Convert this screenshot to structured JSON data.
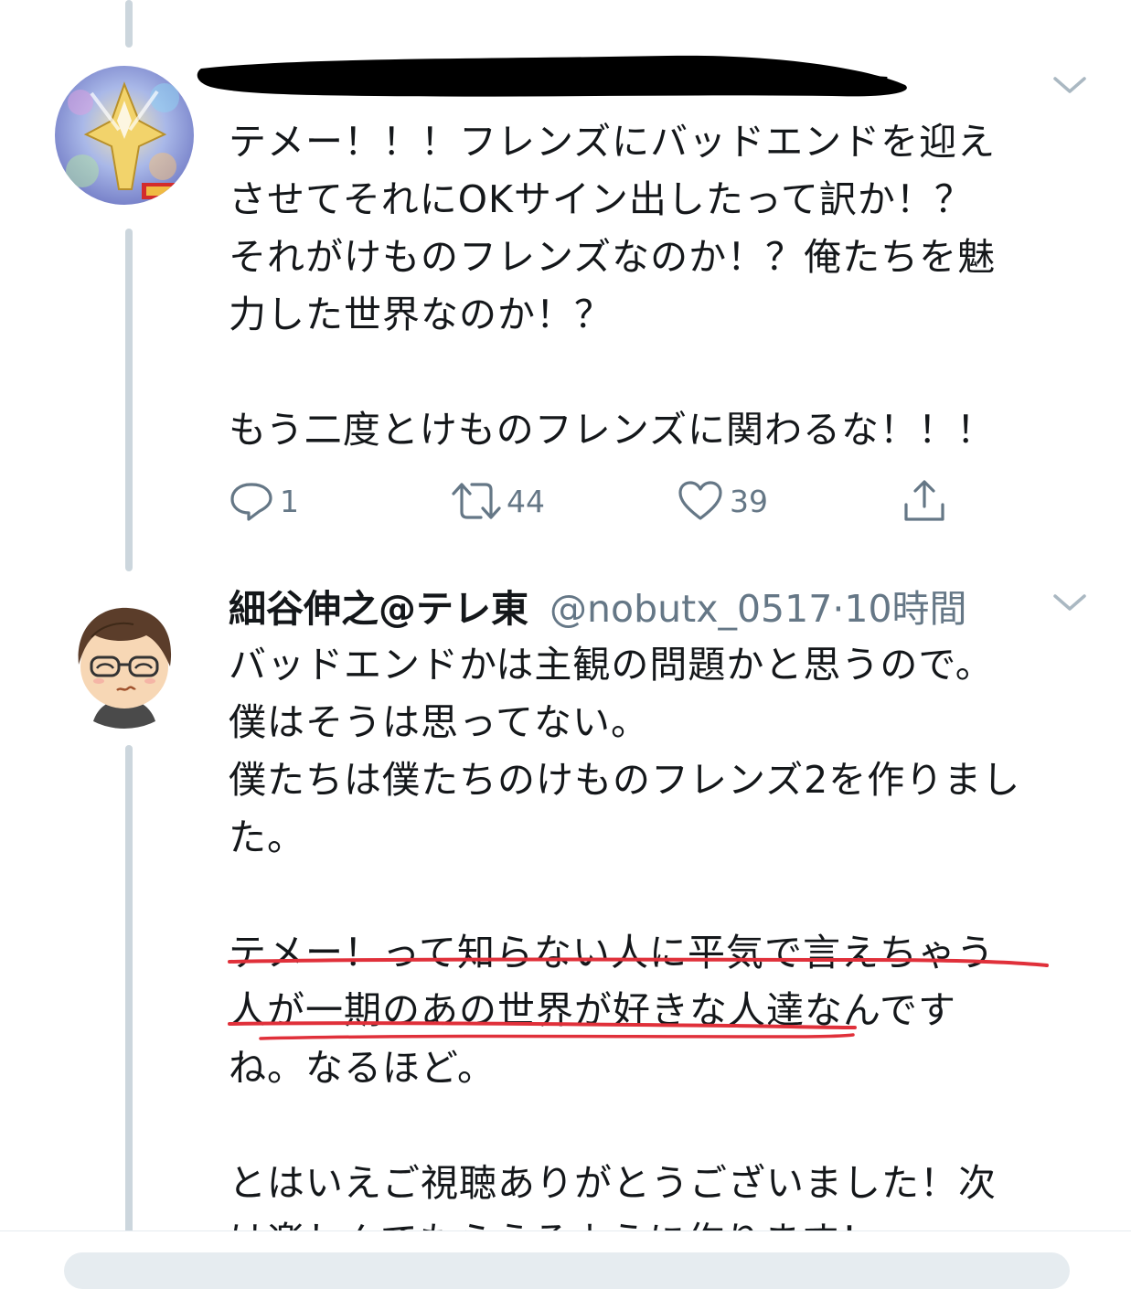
{
  "tweet1": {
    "lines": [
      "テメー！！！フレンズにバッドエンドを迎え",
      "させてそれにOKサイン出したって訳か！？",
      "それがけものフレンズなのか！？俺たちを魅",
      "力した世界なのか！？",
      "",
      "もう二度とけものフレンズに関わるな！！！"
    ],
    "reply_count": "1",
    "retweet_count": "44",
    "like_count": "39"
  },
  "tweet2": {
    "display_name": "細谷伸之@テレ東",
    "handle": "@nobutx_0517",
    "separator": "·",
    "time": "10時間",
    "lines": [
      "バッドエンドかは主観の問題かと思うので。",
      "僕はそうは思ってない。",
      "僕たちは僕たちのけものフレンズ2を作りまし",
      "た。",
      "",
      "テメー！って知らない人に平気で言えちゃう",
      "人が一期のあの世界が好きな人達なんです",
      "ね。なるほど。",
      "",
      "とはいえご視聴ありがとうございました！次",
      "は楽しんでもらえるように作ります！"
    ]
  },
  "colors": {
    "underline": "#e0303a",
    "secondary_text": "#657786",
    "thread_line": "#ccd6dd"
  }
}
